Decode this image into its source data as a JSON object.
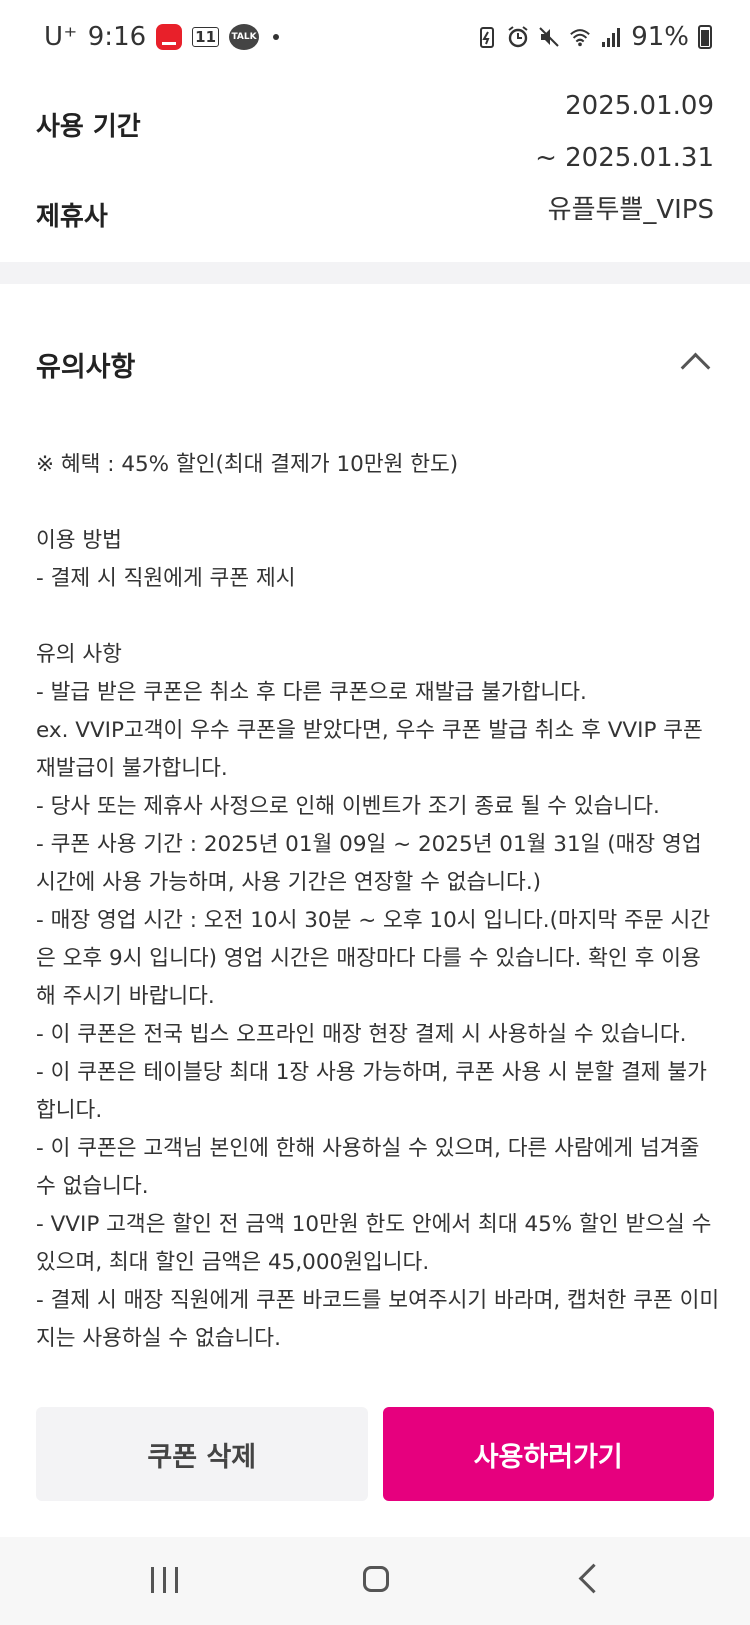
{
  "status_bar": {
    "carrier": "U⁺",
    "time": "9:16",
    "badge_11st": "11",
    "talk_badge": "TALK",
    "battery_percent": "91%"
  },
  "info": {
    "period_label": "사용 기간",
    "period_start": "2025.01.09",
    "period_end": "~ 2025.01.31",
    "partner_label": "제휴사",
    "partner_value": "유플투쁠_VIPS"
  },
  "notice": {
    "title": "유의사항",
    "benefit": "※ 혜택 : 45% 할인(최대 결제가 10만원 한도)",
    "howto_title": "이용 방법",
    "howto_item": "- 결제 시 직원에게 쿠폰 제시",
    "caution_title": "유의 사항",
    "items": [
      "- 발급 받은 쿠폰은 취소 후 다른 쿠폰으로 재발급 불가합니다.",
      "ex. VVIP고객이 우수 쿠폰을 받았다면, 우수 쿠폰 발급 취소 후 VVIP 쿠폰 재발급이 불가합니다.",
      "- 당사 또는 제휴사 사정으로 인해 이벤트가 조기 종료 될 수 있습니다.",
      "- 쿠폰 사용 기간 : 2025년 01월 09일 ~ 2025년 01월 31일 (매장 영업 시간에 사용 가능하며, 사용 기간은 연장할 수 없습니다.)",
      "- 매장 영업 시간 : 오전 10시 30분 ~ 오후 10시 입니다.(마지막 주문 시간은 오후 9시 입니다) 영업 시간은 매장마다 다를 수 있습니다. 확인 후 이용해 주시기 바랍니다.",
      "- 이 쿠폰은 전국 빕스 오프라인 매장 현장 결제 시 사용하실 수 있습니다.",
      "- 이 쿠폰은 테이블당 최대 1장 사용 가능하며, 쿠폰 사용 시 분할 결제 불가합니다.",
      "- 이 쿠폰은 고객님 본인에 한해 사용하실 수 있으며, 다른 사람에게 넘겨줄 수 없습니다.",
      "- VVIP 고객은 할인 전 금액 10만원 한도 안에서 최대 45% 할인 받으실 수 있으며, 최대 할인 금액은 45,000원입니다.",
      "- 결제 시 매장 직원에게 쿠폰 바코드를 보여주시기 바라며, 캡처한 쿠폰 이미지는 사용하실 수 없습니다."
    ]
  },
  "actions": {
    "delete_label": "쿠폰 삭제",
    "use_label": "사용하러가기"
  }
}
